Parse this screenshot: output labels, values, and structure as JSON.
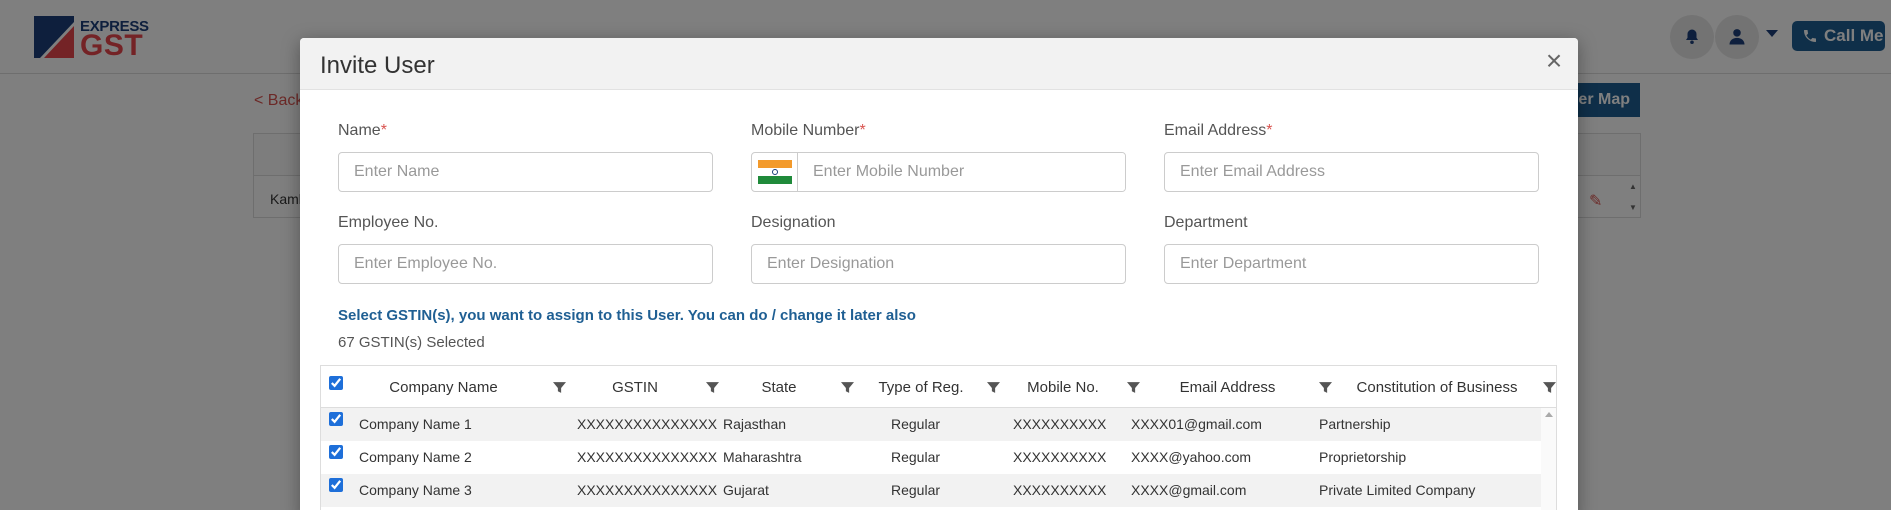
{
  "header": {
    "logo_top": "EXPRESS",
    "logo_bottom": "GST",
    "call_label": "Call Me"
  },
  "background": {
    "back_label": "< Back",
    "map_button_label": "er Map",
    "row_text": "Kaml"
  },
  "modal": {
    "title": "Invite User",
    "close_label": "×",
    "fields": {
      "name": {
        "label": "Name",
        "placeholder": "Enter Name",
        "required": "*"
      },
      "mobile": {
        "label": "Mobile Number",
        "placeholder": "Enter Mobile Number",
        "required": "*"
      },
      "email": {
        "label": "Email Address",
        "placeholder": "Enter Email Address",
        "required": "*"
      },
      "employee_no": {
        "label": "Employee No.",
        "placeholder": "Enter Employee No."
      },
      "designation": {
        "label": "Designation",
        "placeholder": "Enter Designation"
      },
      "department": {
        "label": "Department",
        "placeholder": "Enter Department"
      }
    },
    "assign_note": "Select GSTIN(s), you want to assign to this User. You can do / change it later also",
    "selected_count": "67 GSTIN(s) Selected"
  },
  "grid": {
    "columns": [
      "Company Name",
      "GSTIN",
      "State",
      "Type of Reg.",
      "Mobile No.",
      "Email Address",
      "Constitution of Business"
    ],
    "rows": [
      [
        "Company Name 1",
        "XXXXXXXXXXXXXXX",
        "Rajasthan",
        "Regular",
        "XXXXXXXXXX",
        "XXXX01@gmail.com",
        "Partnership"
      ],
      [
        "Company Name 2",
        "XXXXXXXXXXXXXXX",
        "Maharashtra",
        "Regular",
        "XXXXXXXXXX",
        "XXXX@yahoo.com",
        "Proprietorship"
      ],
      [
        "Company Name 3",
        "XXXXXXXXXXXXXXX",
        "Gujarat",
        "Regular",
        "XXXXXXXXXX",
        "XXXX@gmail.com",
        "Private Limited Company"
      ]
    ]
  },
  "colors": {
    "brand_blue": "#1f5f93",
    "brand_red": "#e8474c",
    "required_red": "#d9534f",
    "flag_saffron": "#f39a2b",
    "flag_green": "#1f8a3a",
    "flag_chakra": "#1c3f7a"
  }
}
